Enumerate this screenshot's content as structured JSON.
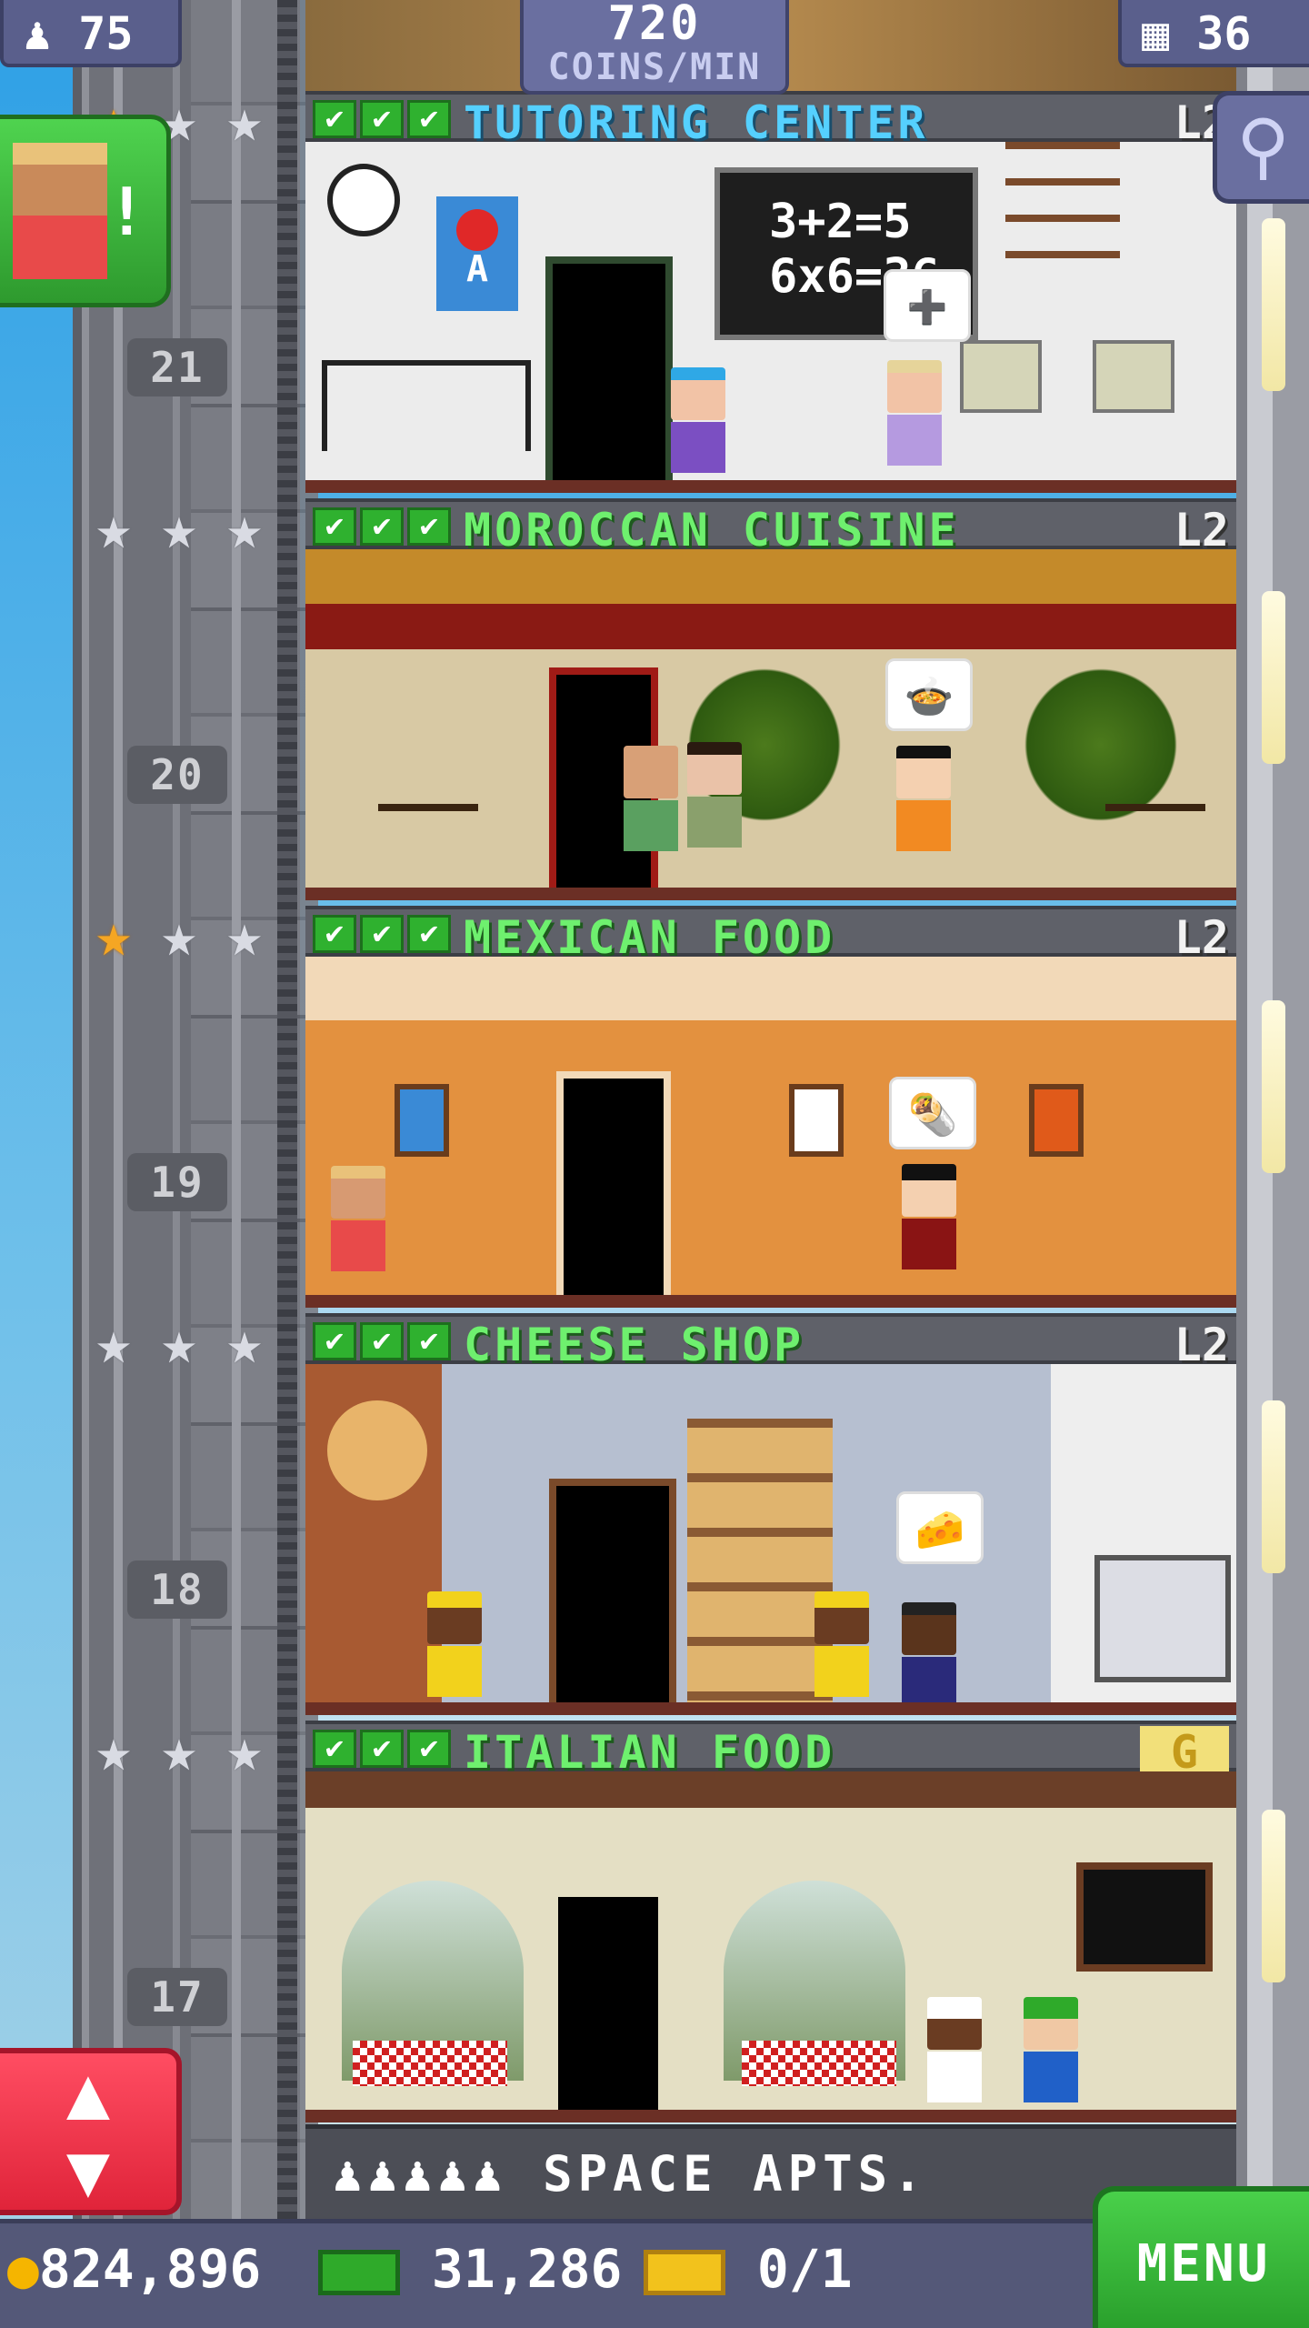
{
  "top_bar": {
    "population": "75",
    "coins_per_min_value": "720",
    "coins_per_min_label": "COINS/MIN",
    "floors_count": "36"
  },
  "floors": [
    {
      "number": "21",
      "name": "TUTORING CENTER",
      "level": "L2",
      "checks": "✔",
      "stars": [
        "gold",
        "silver",
        "silver"
      ],
      "chalkboard": "3+2=5\n6x6=36"
    },
    {
      "number": "20",
      "name": "MOROCCAN CUISINE",
      "level": "L2",
      "checks": "✔",
      "stars": [
        "silver",
        "silver",
        "silver"
      ]
    },
    {
      "number": "19",
      "name": "MEXICAN FOOD",
      "level": "L2",
      "checks": "✔",
      "stars": [
        "gold",
        "silver",
        "silver"
      ]
    },
    {
      "number": "18",
      "name": "CHEESE SHOP",
      "level": "L2",
      "checks": "✔",
      "stars": [
        "silver",
        "silver",
        "silver"
      ]
    },
    {
      "number": "17",
      "name": "ITALIAN FOOD",
      "level": "G",
      "checks": "✔",
      "stars": [
        "silver",
        "silver",
        "silver"
      ]
    }
  ],
  "lobby": {
    "name": "SPACE APTS."
  },
  "bottom_bar": {
    "coins": "824,896",
    "bux": "31,286",
    "tickets": "0/1",
    "menu_label": "MENU"
  },
  "colors": {
    "accent_green": "#6ef06e",
    "menu_green": "#2aa02c",
    "elevator_red": "#e0243a"
  }
}
